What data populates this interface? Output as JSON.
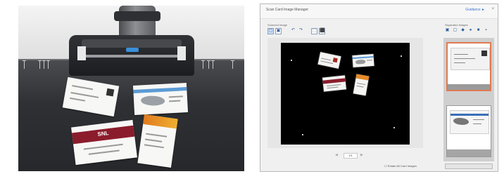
{
  "window": {
    "title": "Scan Card Image Manager",
    "top_link": "Guidance ►",
    "close_glyph": "×"
  },
  "left_panel": {
    "label": "Scanned Image"
  },
  "right_panel": {
    "label": "Separated Images"
  },
  "toolbar": {
    "buttons": [
      "▢",
      "▣",
      "↶",
      "↷",
      "⬚",
      "⬛"
    ]
  },
  "right_toolbar": {
    "buttons": [
      "▣",
      "▢",
      "◆",
      "●",
      "■",
      "▪"
    ]
  },
  "navigation": {
    "page": "1/1",
    "prev": "◀",
    "next": "▶"
  },
  "status": {
    "text": "☐ Rotate All Card Images"
  },
  "photo": {
    "card_logo": "SNL",
    "colors": {
      "accent_blue": "#5b9bd5",
      "card_red": "#8b1c2c",
      "card_orange": "#e07a1f",
      "led": "#3a8fd8"
    }
  },
  "thumbnails": {
    "selected_color": "#e07a50"
  }
}
